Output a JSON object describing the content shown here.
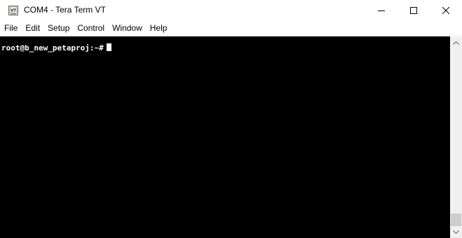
{
  "window": {
    "title": "COM4 - Tera Term VT",
    "app_icon": "tera-term-vt-icon",
    "buttons": [
      "minimize-icon",
      "maximize-icon",
      "close-icon"
    ]
  },
  "menu": {
    "items": [
      {
        "label": "File"
      },
      {
        "label": "Edit"
      },
      {
        "label": "Setup"
      },
      {
        "label": "Control"
      },
      {
        "label": "Window"
      },
      {
        "label": "Help"
      }
    ]
  },
  "terminal": {
    "prompt": "root@b_new_petaproj:~#",
    "background": "#000000",
    "foreground": "#ffffff"
  },
  "scrollbar": {
    "position": 1.0
  }
}
